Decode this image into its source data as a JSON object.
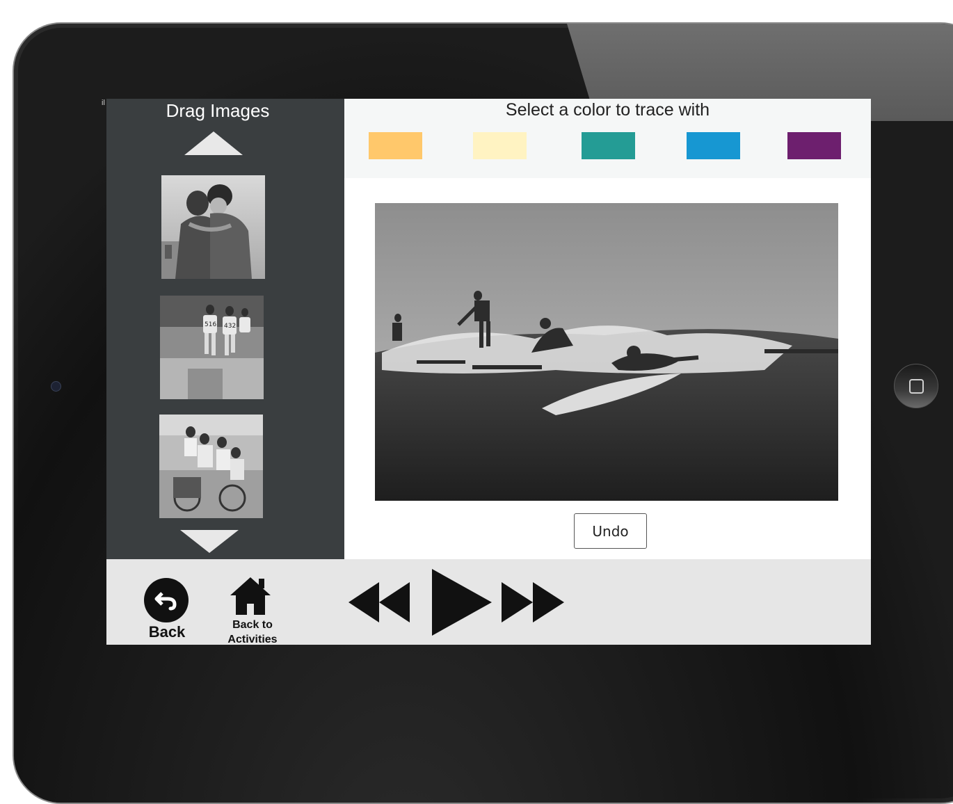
{
  "left_panel": {
    "title": "Drag Images",
    "thumbnails": [
      {
        "icon": "couple-kissing-photo"
      },
      {
        "icon": "runners-race-photo"
      },
      {
        "icon": "family-bicycle-photo"
      }
    ]
  },
  "color_picker": {
    "title": "Select a color to trace with",
    "swatches": [
      {
        "name": "orange",
        "color": "#ffc86b"
      },
      {
        "name": "cream",
        "color": "#fff3c2"
      },
      {
        "name": "teal",
        "color": "#249c95"
      },
      {
        "name": "blue",
        "color": "#1797d2"
      },
      {
        "name": "purple",
        "color": "#6d1f6e"
      }
    ]
  },
  "canvas": {
    "icon": "surfers-photo",
    "undo_label": "Undo"
  },
  "bottom_bar": {
    "back_label": "Back",
    "back_to_activities_line1": "Back to",
    "back_to_activities_line2": "Activities"
  },
  "device": {
    "status_mark": "il"
  }
}
